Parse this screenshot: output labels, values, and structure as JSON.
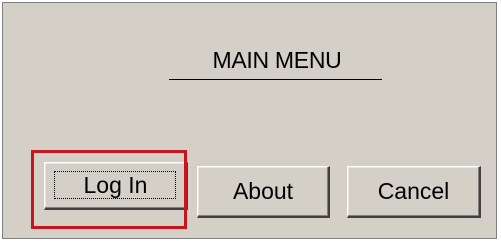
{
  "menu": {
    "title": "MAIN MENU"
  },
  "buttons": {
    "login_label": "Log In",
    "about_label": "About",
    "cancel_label": "Cancel"
  },
  "colors": {
    "window_background": "#d4d0c8",
    "highlight_border": "#c6151f"
  }
}
